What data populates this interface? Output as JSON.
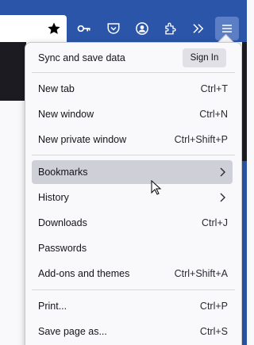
{
  "toolbar": {
    "icons": [
      "star-icon",
      "key-icon",
      "pocket-icon",
      "account-icon",
      "extensions-icon",
      "overflow-chevrons-icon",
      "hamburger-menu-icon"
    ]
  },
  "menu": {
    "sync_label": "Sync and save data",
    "signin_label": "Sign In",
    "groups": [
      [
        {
          "label": "New tab",
          "shortcut": "Ctrl+T"
        },
        {
          "label": "New window",
          "shortcut": "Ctrl+N"
        },
        {
          "label": "New private window",
          "shortcut": "Ctrl+Shift+P"
        }
      ],
      [
        {
          "label": "Bookmarks",
          "submenu": true,
          "highlighted": true
        },
        {
          "label": "History",
          "submenu": true
        },
        {
          "label": "Downloads",
          "shortcut": "Ctrl+J"
        },
        {
          "label": "Passwords"
        },
        {
          "label": "Add-ons and themes",
          "shortcut": "Ctrl+Shift+A"
        }
      ],
      [
        {
          "label": "Print...",
          "shortcut": "Ctrl+P"
        },
        {
          "label": "Save page as...",
          "shortcut": "Ctrl+S"
        }
      ]
    ]
  },
  "colors": {
    "toolbar": "#2b55a8",
    "panel": "#f9f9fb",
    "highlight": "#cfcfd8"
  }
}
